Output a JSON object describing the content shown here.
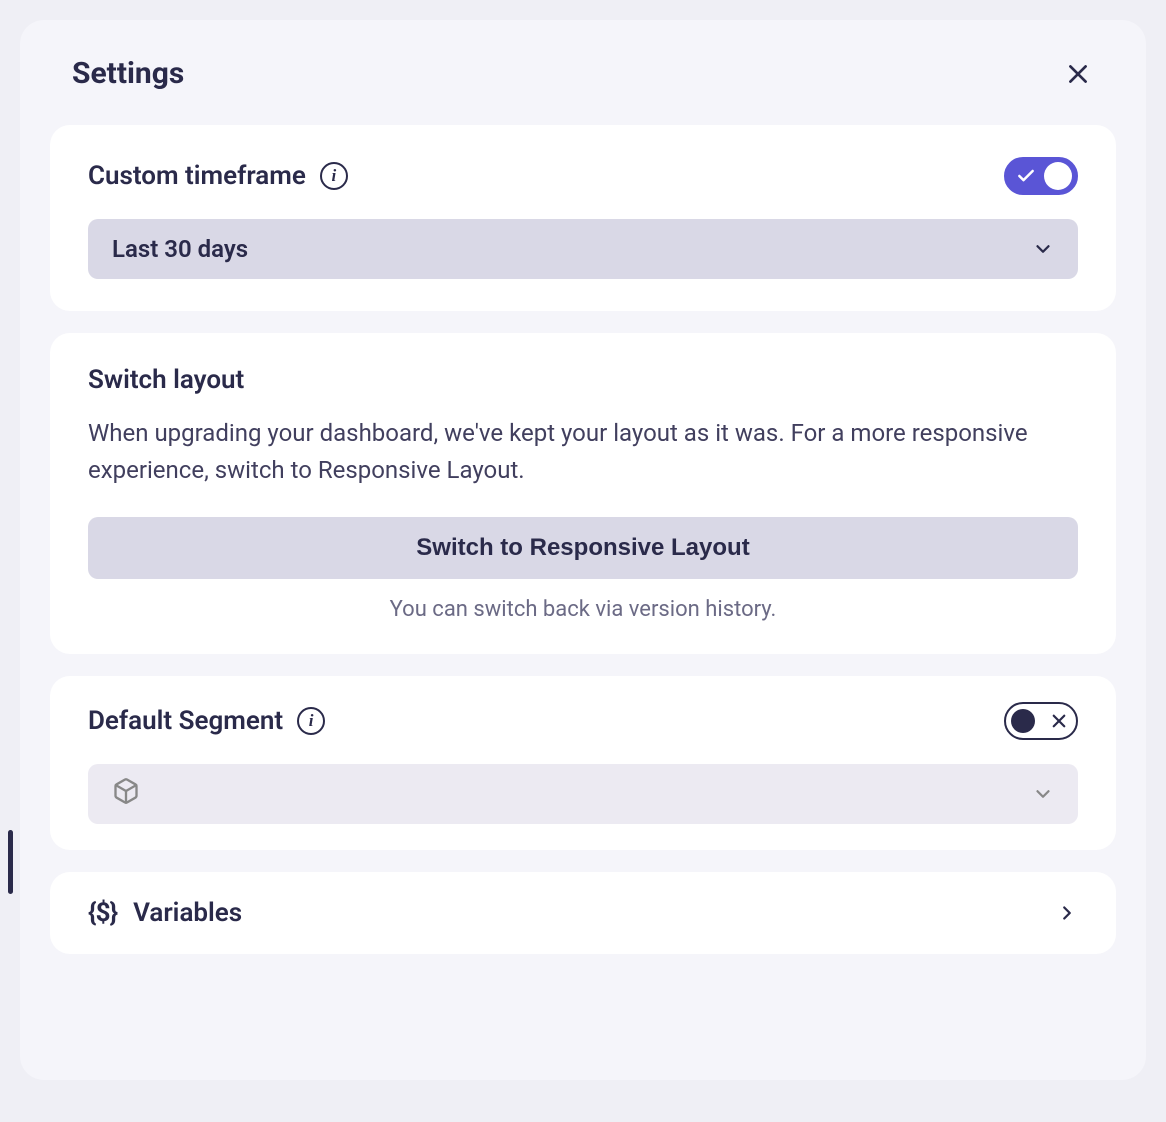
{
  "panel": {
    "title": "Settings"
  },
  "customTimeframe": {
    "label": "Custom timeframe",
    "toggle": true,
    "selected": "Last 30 days"
  },
  "switchLayout": {
    "label": "Switch layout",
    "description": "When upgrading your dashboard, we've kept your layout as it was. For a more responsive experience, switch to Responsive Layout.",
    "button": "Switch to Responsive Layout",
    "hint": "You can switch back via version history."
  },
  "defaultSegment": {
    "label": "Default Segment",
    "toggle": false,
    "selected": ""
  },
  "variables": {
    "label": "Variables"
  }
}
